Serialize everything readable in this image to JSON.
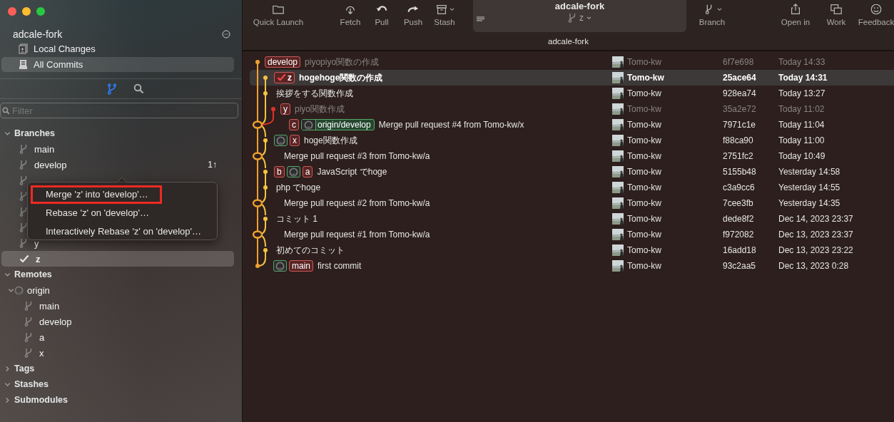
{
  "sidebar": {
    "repo": "adcale-fork",
    "nav": [
      {
        "label": "Local Changes",
        "kind": "changes",
        "selected": false
      },
      {
        "label": "All Commits",
        "kind": "commits",
        "selected": true
      }
    ],
    "views": [
      {
        "kind": "branches",
        "selected": true
      },
      {
        "kind": "search",
        "selected": false
      }
    ],
    "filter": {
      "placeholder": "Filter"
    },
    "sections": [
      {
        "title": "Branches",
        "expanded": true,
        "items": [
          {
            "kind": "branch",
            "name": "main",
            "selected": false
          },
          {
            "kind": "branch",
            "name": "develop",
            "badge": "1↑",
            "selected": false
          },
          {
            "kind": "covered",
            "selected": false
          },
          {
            "kind": "covered",
            "selected": false
          },
          {
            "kind": "covered",
            "selected": false
          },
          {
            "kind": "covered",
            "selected": false
          },
          {
            "kind": "branch",
            "name": "y",
            "selected": false
          },
          {
            "kind": "current",
            "name": "z",
            "selected": true
          }
        ]
      },
      {
        "title": "Remotes",
        "expanded": true,
        "items": [
          {
            "kind": "remote",
            "name": "origin",
            "expanded": true,
            "selected": false,
            "children": [
              {
                "kind": "branch",
                "name": "main",
                "selected": false
              },
              {
                "kind": "branch",
                "name": "develop",
                "selected": false
              },
              {
                "kind": "branch",
                "name": "a",
                "selected": false
              },
              {
                "kind": "branch",
                "name": "x",
                "selected": false
              }
            ]
          }
        ]
      },
      {
        "title": "Tags",
        "expanded": false
      },
      {
        "title": "Stashes",
        "expanded": true
      },
      {
        "title": "Submodules",
        "expanded": false
      }
    ]
  },
  "context_menu": {
    "items": [
      {
        "label": "Merge 'z' into 'develop'…",
        "highlighted": true
      },
      {
        "label": "Rebase 'z' on 'develop'…",
        "highlighted": false
      },
      {
        "label": "Interactively Rebase 'z' on 'develop'…",
        "highlighted": false
      }
    ]
  },
  "toolbar": {
    "left": [
      {
        "label": "Quick Launch",
        "kind": "folder",
        "dropdown": false
      },
      {
        "label": "Fetch",
        "kind": "fetch",
        "dropdown": false
      },
      {
        "label": "Pull",
        "kind": "pull",
        "dropdown": false
      },
      {
        "label": "Push",
        "kind": "push",
        "dropdown": false
      },
      {
        "label": "Stash",
        "kind": "stash",
        "dropdown": true
      }
    ],
    "repo": {
      "title": "adcale-fork",
      "branch": "z"
    },
    "right": [
      {
        "label": "Branch",
        "kind": "branch",
        "dropdown": true
      },
      {
        "label": "Open in",
        "kind": "share",
        "dropdown": false
      },
      {
        "label": "Work",
        "kind": "windows",
        "dropdown": false
      },
      {
        "label": "Feedback",
        "kind": "smile",
        "dropdown": false
      }
    ]
  },
  "tab": "adcale-fork",
  "commits": [
    {
      "kind": "top",
      "refs": [
        {
          "kind": "local",
          "name": "develop"
        }
      ],
      "message": "piyopiyo関数の作成",
      "author": "Tomo-kw",
      "hash": "6f7e698",
      "date": "Today 14:33",
      "selected": false,
      "dimmed": true
    },
    {
      "kind": "side",
      "refs": [
        {
          "kind": "head",
          "name": "z"
        }
      ],
      "message": "hogehoge関数の作成",
      "author": "Tomo-kw",
      "hash": "25ace64",
      "date": "Today 14:31",
      "selected": true,
      "dimmed": false
    },
    {
      "kind": "side",
      "message": "挨拶をする関数作成",
      "author": "Tomo-kw",
      "hash": "928ea74",
      "date": "Today 13:27",
      "selected": false,
      "dimmed": false
    },
    {
      "kind": "fork",
      "refs": [
        {
          "kind": "local",
          "name": "y"
        }
      ],
      "message": "piyo関数作成",
      "author": "Tomo-kw",
      "hash": "35a2e72",
      "date": "Today 11:02",
      "selected": false,
      "dimmed": true
    },
    {
      "kind": "merge-fork",
      "refs": [
        {
          "kind": "local",
          "name": "c"
        },
        {
          "kind": "remote",
          "name": "origin/develop"
        }
      ],
      "message": "Merge pull request #4 from Tomo-kw/x",
      "author": "Tomo-kw",
      "hash": "7971c1e",
      "date": "Today 11:04",
      "selected": false,
      "dimmed": false
    },
    {
      "kind": "side",
      "refs": [
        {
          "kind": "remote-mark"
        },
        {
          "kind": "local",
          "name": "x"
        }
      ],
      "message": "hoge関数作成",
      "author": "Tomo-kw",
      "hash": "f88ca90",
      "date": "Today 11:00",
      "selected": false,
      "dimmed": false
    },
    {
      "kind": "merge",
      "message": "Merge pull request #3 from Tomo-kw/a",
      "author": "Tomo-kw",
      "hash": "2751fc2",
      "date": "Today 10:49",
      "selected": false,
      "dimmed": false
    },
    {
      "kind": "side",
      "refs": [
        {
          "kind": "local",
          "name": "b"
        },
        {
          "kind": "remote-mark"
        },
        {
          "kind": "local",
          "name": "a"
        }
      ],
      "message": "JavaScript でhoge",
      "author": "Tomo-kw",
      "hash": "5155b48",
      "date": "Yesterday 14:58",
      "selected": false,
      "dimmed": false
    },
    {
      "kind": "side",
      "message": "php でhoge",
      "author": "Tomo-kw",
      "hash": "c3a9cc6",
      "date": "Yesterday 14:55",
      "selected": false,
      "dimmed": false
    },
    {
      "kind": "merge",
      "message": "Merge pull request #2 from Tomo-kw/a",
      "author": "Tomo-kw",
      "hash": "7cee3fb",
      "date": "Yesterday 14:35",
      "selected": false,
      "dimmed": false
    },
    {
      "kind": "side",
      "message": "コミット 1",
      "author": "Tomo-kw",
      "hash": "dede8f2",
      "date": "Dec 14, 2023 23:37",
      "selected": false,
      "dimmed": false
    },
    {
      "kind": "merge",
      "message": "Merge pull request #1 from Tomo-kw/a",
      "author": "Tomo-kw",
      "hash": "f972082",
      "date": "Dec 13, 2023 23:37",
      "selected": false,
      "dimmed": false
    },
    {
      "kind": "side",
      "message": "初めてのコミット",
      "author": "Tomo-kw",
      "hash": "16add18",
      "date": "Dec 13, 2023 23:22",
      "selected": false,
      "dimmed": false
    },
    {
      "kind": "root",
      "refs": [
        {
          "kind": "remote-mark"
        },
        {
          "kind": "local",
          "name": "main"
        }
      ],
      "message": "first commit",
      "author": "Tomo-kw",
      "hash": "93c2aa5",
      "date": "Dec 13, 2023 0:28",
      "selected": false,
      "dimmed": false
    }
  ]
}
